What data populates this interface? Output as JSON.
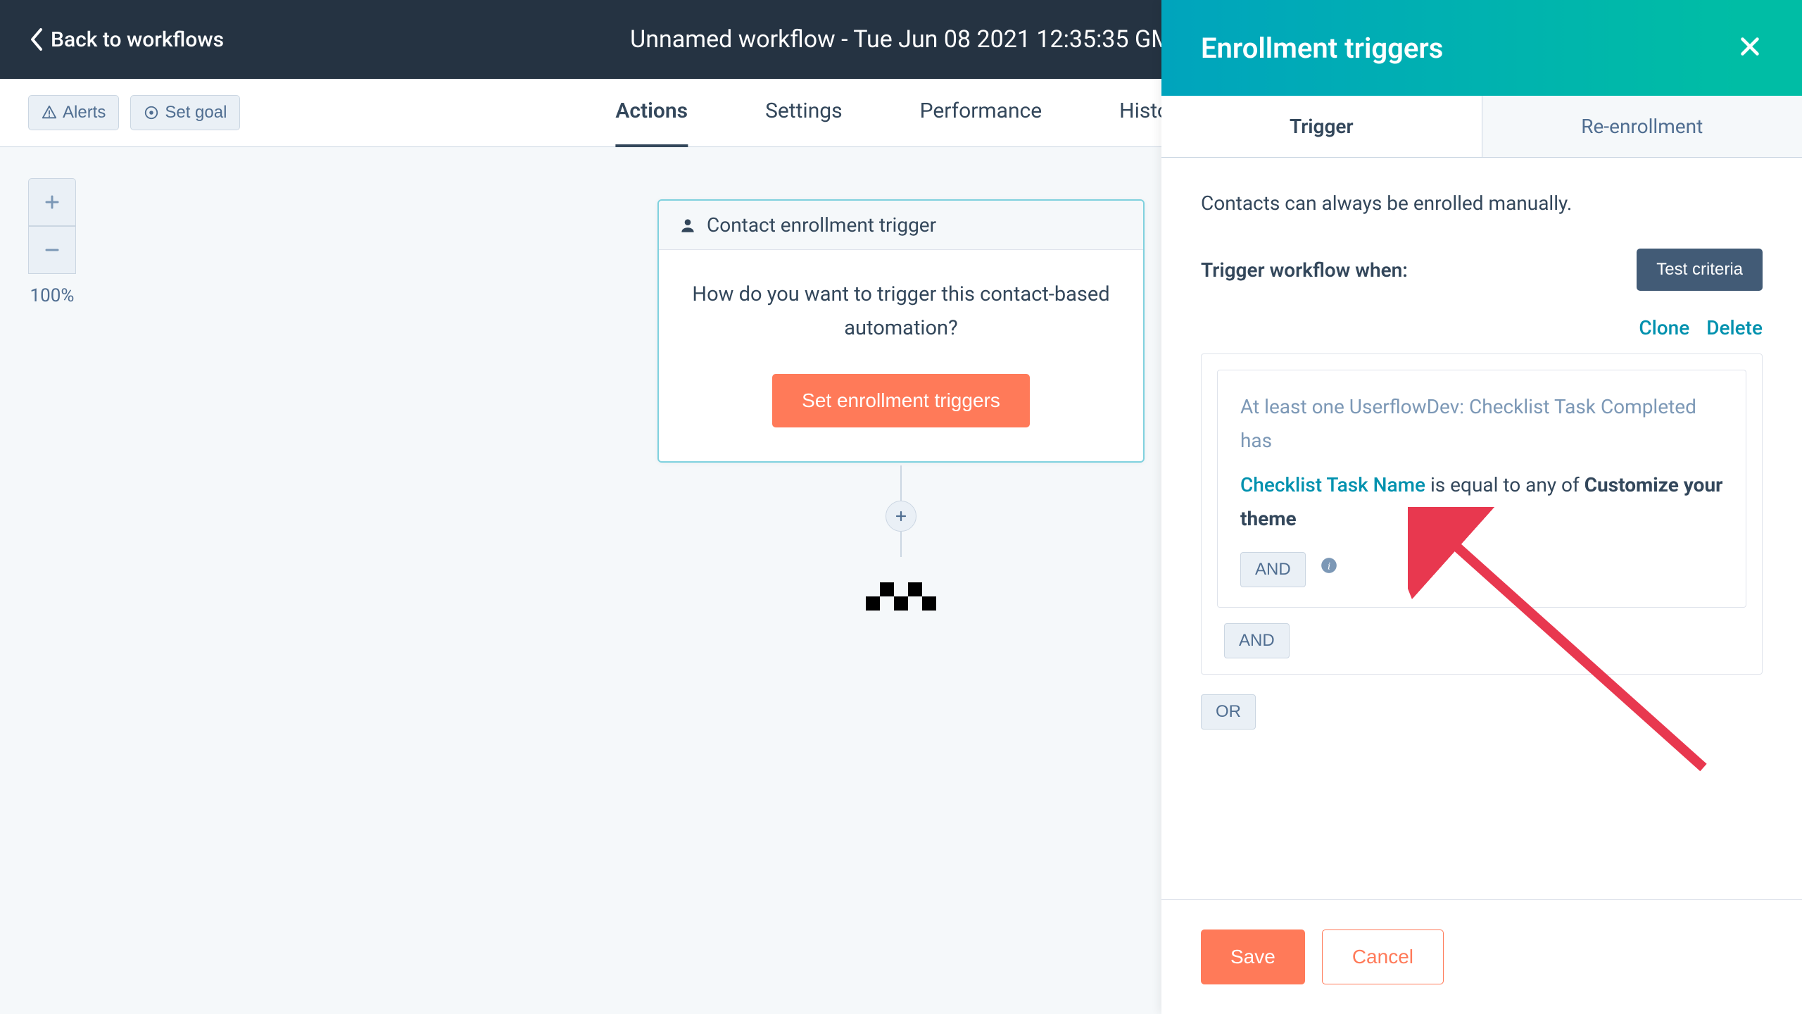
{
  "top_nav": {
    "back_label": "Back to workflows",
    "title": "Unnamed workflow - Tue Jun 08 2021 12:35:35 GM"
  },
  "toolbar": {
    "alerts_label": "Alerts",
    "set_goal_label": "Set goal"
  },
  "tabs": {
    "actions": "Actions",
    "settings": "Settings",
    "performance": "Performance",
    "history": "History"
  },
  "zoom": {
    "level_label": "100%"
  },
  "enrollment_card": {
    "header": "Contact enrollment trigger",
    "prompt": "How do you want to trigger this contact-based automation?",
    "button": "Set enrollment triggers"
  },
  "side_panel": {
    "title": "Enrollment triggers",
    "tabs": {
      "trigger": "Trigger",
      "reenrollment": "Re-enrollment"
    },
    "hint": "Contacts can always be enrolled manually.",
    "trigger_when": "Trigger workflow when:",
    "test_criteria": "Test criteria",
    "actions": {
      "clone": "Clone",
      "delete": "Delete"
    },
    "filter": {
      "prefix": "At least one UserflowDev: Checklist Task Completed has",
      "field_name": "Checklist Task Name",
      "operator_text": " is equal to any of ",
      "value": "Customize your theme",
      "and_label": "AND",
      "or_label": "OR"
    },
    "footer": {
      "save": "Save",
      "cancel": "Cancel"
    }
  }
}
